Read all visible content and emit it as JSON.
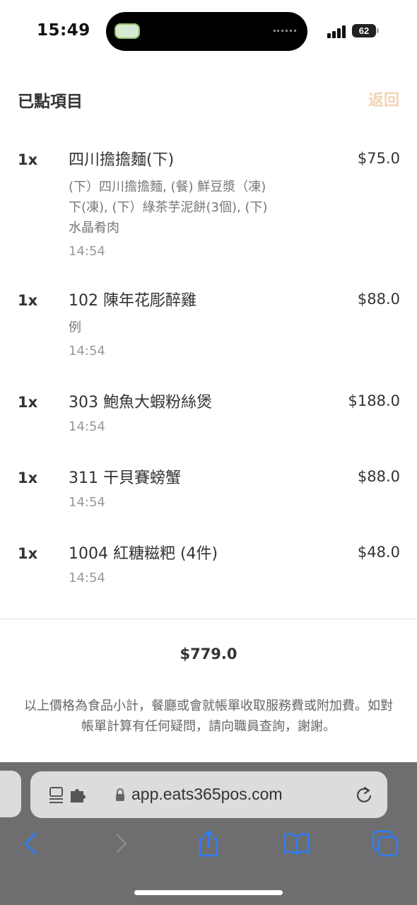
{
  "status_bar": {
    "time": "15:49",
    "battery": "62"
  },
  "header": {
    "title": "已點項目",
    "back_label": "返回"
  },
  "items": [
    {
      "qty": "1x",
      "name": "四川擔擔麵(下)",
      "options": "(下）四川擔擔麵, (餐) 鮮豆漿（凍)\n下(凍), (下）綠茶芋泥餅(3個), (下)\n水晶肴肉",
      "time": "14:54",
      "price": "$75.0"
    },
    {
      "qty": "1x",
      "name": "102 陳年花彫醉雞",
      "options": "例",
      "time": "14:54",
      "price": "$88.0"
    },
    {
      "qty": "1x",
      "name": "303 鮑魚大蝦粉絲煲",
      "options": "",
      "time": "14:54",
      "price": "$188.0"
    },
    {
      "qty": "1x",
      "name": "311 干貝賽螃蟹",
      "options": "",
      "time": "14:54",
      "price": "$88.0"
    },
    {
      "qty": "1x",
      "name": "1004 紅糖糍粑 (4件)",
      "options": "",
      "time": "14:54",
      "price": "$48.0"
    }
  ],
  "total": "$779.0",
  "note": "以上價格為食品小計，餐廳或會就帳單收取服務費或附加費。如對帳單計算有任何疑問，請向職員查詢，謝謝。",
  "browser": {
    "url": "app.eats365pos.com"
  },
  "colors": {
    "back_accent": "#f0d4b4",
    "toolbar_blue": "#2f7cf6",
    "toolbar_bg": "#6e6e70"
  }
}
